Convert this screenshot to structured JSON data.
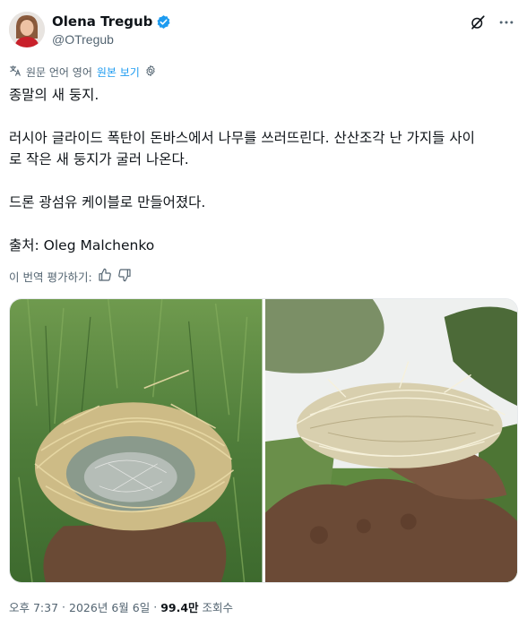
{
  "author": {
    "name": "Olena Tregub",
    "handle": "@OTregub"
  },
  "translation_bar": {
    "source_label": "원문 언어 영어",
    "show_original": "원본 보기"
  },
  "tweet": {
    "line1": "종말의 새 둥지.",
    "line2": "러시아 글라이드 폭탄이 돈바스에서 나무를 쓰러뜨린다. 산산조각 난 가지들 사이",
    "line3": "로 작은 새 둥지가 굴러 나온다.",
    "line4": "드론 광섬유 케이블로 만들어졌다.",
    "line5": "출처: Oleg Malchenko"
  },
  "rate_translation": "이 번역 평가하기:",
  "meta": {
    "time": "오후 7:37",
    "dot1": "·",
    "date": "2026년 6월 6일",
    "dot2": "·",
    "views": "99.4만",
    "views_label": "조회수"
  },
  "colors": {
    "accent": "#1d9bf0",
    "secondary_text": "#536471",
    "primary_text": "#0f1419"
  },
  "icons": [
    "verified-badge-icon",
    "grok-icon",
    "more-icon",
    "translate-icon",
    "settings-icon",
    "thumbs-up-icon",
    "thumbs-down-icon"
  ]
}
